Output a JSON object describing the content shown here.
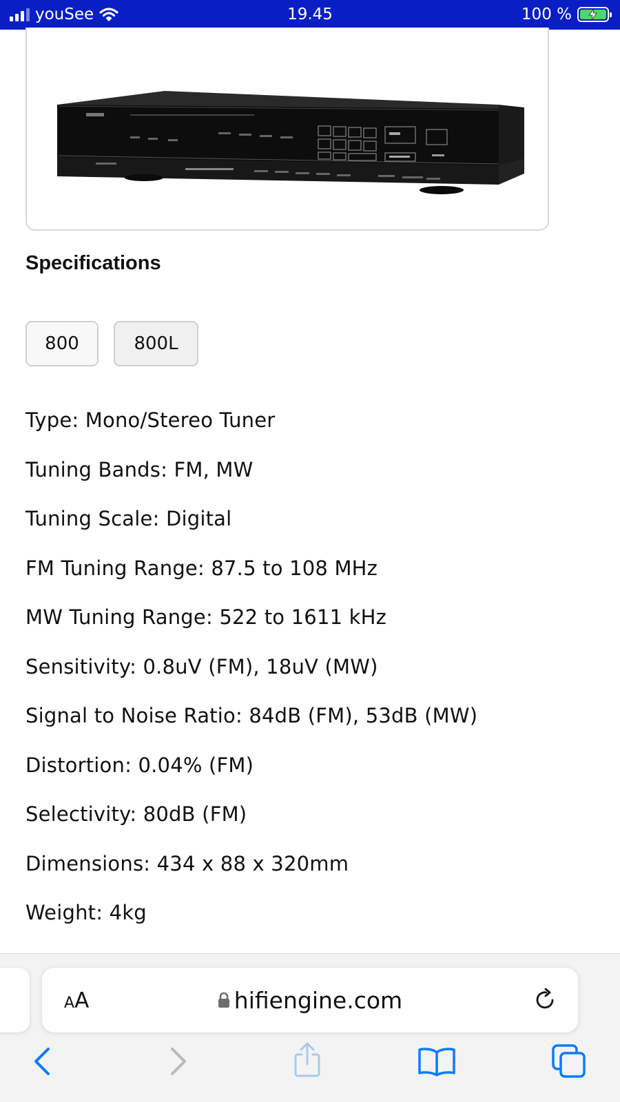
{
  "status_bar": {
    "carrier": "youSee",
    "time": "19.45",
    "battery": "100 %",
    "icons": [
      "cellular-signal-icon",
      "wifi-icon",
      "battery-charging-icon"
    ]
  },
  "product": {
    "image_icon": "tuner-product-photo"
  },
  "specifications": {
    "heading": "Specifications",
    "variants": [
      "800",
      "800L"
    ],
    "lines": [
      "Type: Mono/Stereo Tuner",
      "Tuning Bands: FM, MW",
      "Tuning Scale: Digital",
      "FM Tuning Range: 87.5 to 108 MHz",
      "MW Tuning Range: 522 to 1611 kHz",
      "Sensitivity: 0.8uV (FM), 18uV (MW)",
      "Signal to Noise Ratio: 84dB (FM), 53dB (MW)",
      "Distortion: 0.04% (FM)",
      "Selectivity: 80dB (FM)",
      "Dimensions: 434 x 88 x 320mm",
      "Weight: 4kg"
    ]
  },
  "browser": {
    "aa_small": "A",
    "aa_large": "A",
    "url": "hifiengine.com",
    "colors": {
      "accent": "#0a7aff",
      "disabled": "#b8b8b8",
      "status_bar": "#0a1ec6"
    },
    "toolbar_icons": [
      "back-icon",
      "forward-icon",
      "share-icon",
      "bookmarks-icon",
      "tabs-icon"
    ]
  }
}
